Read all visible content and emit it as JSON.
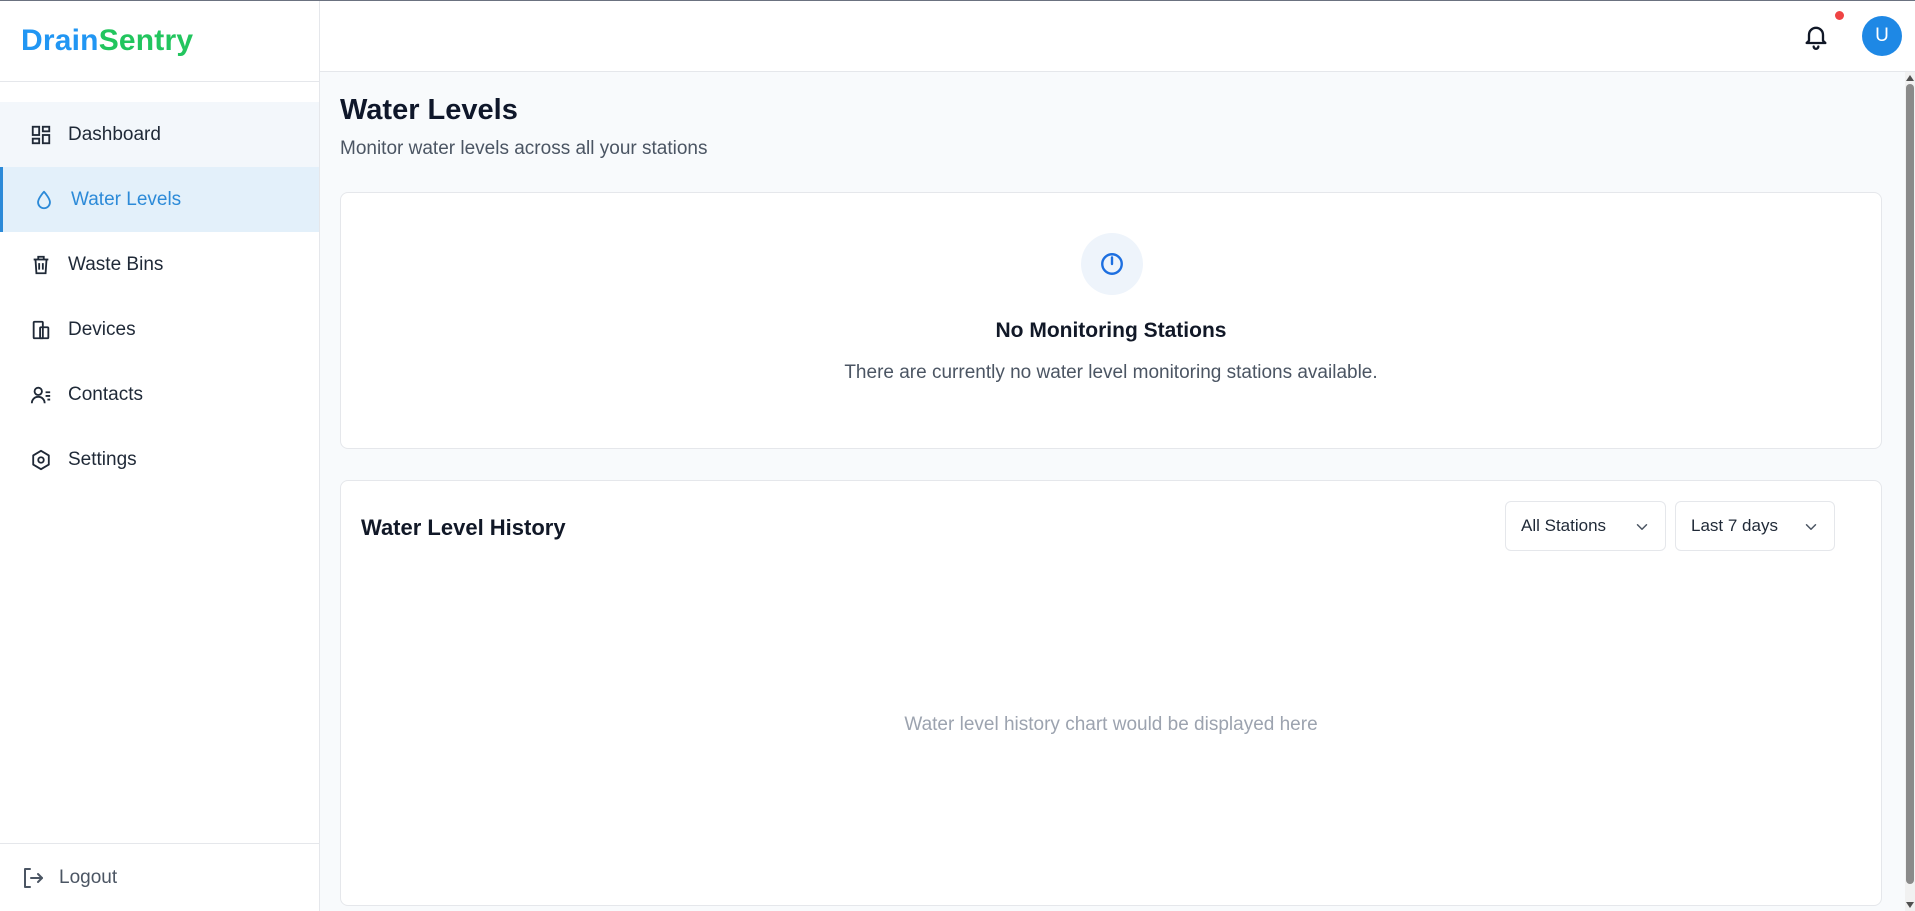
{
  "brand": {
    "part1": "Drain",
    "part2": "Sentry"
  },
  "sidebar": {
    "items": [
      {
        "label": "Dashboard",
        "icon": "dashboard-icon"
      },
      {
        "label": "Water Levels",
        "icon": "water-drop-icon",
        "active": true
      },
      {
        "label": "Waste Bins",
        "icon": "trash-bin-icon"
      },
      {
        "label": "Devices",
        "icon": "devices-icon"
      },
      {
        "label": "Contacts",
        "icon": "contacts-icon"
      },
      {
        "label": "Settings",
        "icon": "settings-icon"
      }
    ],
    "logout_label": "Logout"
  },
  "header": {
    "avatar_initial": "U",
    "has_unread_notifications": true
  },
  "page": {
    "title": "Water Levels",
    "subtitle": "Monitor water levels across all your stations"
  },
  "empty_state": {
    "icon": "power-icon",
    "title": "No Monitoring Stations",
    "description": "There are currently no water level monitoring stations available."
  },
  "history": {
    "title": "Water Level History",
    "station_filter": "All Stations",
    "range_filter": "Last 7 days",
    "placeholder": "Water level history chart would be displayed here"
  },
  "colors": {
    "accent": "#2c8ad8",
    "brand_blue": "#2196f3",
    "brand_green": "#22c55e",
    "notification_dot": "#ef4444"
  }
}
